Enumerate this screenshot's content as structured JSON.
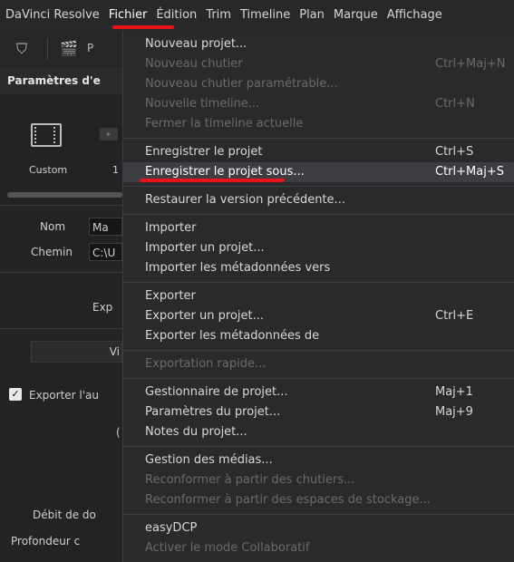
{
  "menubar": {
    "items": [
      "DaVinci Resolve",
      "Fichier",
      "Édition",
      "Trim",
      "Timeline",
      "Plan",
      "Marque",
      "Affichage"
    ],
    "active_index": 1
  },
  "left_panel": {
    "section_title": "Paramètres d'e",
    "preset_custom_label": "Custom",
    "preset_second_label": "1",
    "nom_label": "Nom",
    "nom_value": "Ma",
    "chemin_label": "Chemin",
    "chemin_value": "C:\\U",
    "export_label": "Exp",
    "vi_button": "Vi",
    "export_audio_label": "Exporter l'au",
    "c_label": "(",
    "debit_label": "Débit de do",
    "profondeur_label": "Profondeur c"
  },
  "dropdown": {
    "groups": [
      [
        {
          "label": "Nouveau projet...",
          "shortcut": "",
          "disabled": false
        },
        {
          "label": "Nouveau chutier",
          "shortcut": "Ctrl+Maj+N",
          "disabled": true
        },
        {
          "label": "Nouveau chutier paramétrable...",
          "shortcut": "",
          "disabled": true
        },
        {
          "label": "Nouvelle timeline...",
          "shortcut": "Ctrl+N",
          "disabled": true
        },
        {
          "label": "Fermer la timeline actuelle",
          "shortcut": "",
          "disabled": true
        }
      ],
      [
        {
          "label": "Enregistrer le projet",
          "shortcut": "Ctrl+S",
          "disabled": false
        },
        {
          "label": "Enregistrer le projet sous...",
          "shortcut": "Ctrl+Maj+S",
          "disabled": false,
          "hover": true
        }
      ],
      [
        {
          "label": "Restaurer la version précédente...",
          "shortcut": "",
          "disabled": false
        }
      ],
      [
        {
          "label": "Importer",
          "shortcut": "",
          "disabled": false
        },
        {
          "label": "Importer un projet...",
          "shortcut": "",
          "disabled": false
        },
        {
          "label": "Importer les métadonnées vers",
          "shortcut": "",
          "disabled": false
        }
      ],
      [
        {
          "label": "Exporter",
          "shortcut": "",
          "disabled": false
        },
        {
          "label": "Exporter un projet...",
          "shortcut": "Ctrl+E",
          "disabled": false
        },
        {
          "label": "Exporter les métadonnées de",
          "shortcut": "",
          "disabled": false
        }
      ],
      [
        {
          "label": "Exportation rapide...",
          "shortcut": "",
          "disabled": true
        }
      ],
      [
        {
          "label": "Gestionnaire de projet...",
          "shortcut": "Maj+1",
          "disabled": false
        },
        {
          "label": "Paramètres du projet...",
          "shortcut": "Maj+9",
          "disabled": false
        },
        {
          "label": "Notes du projet...",
          "shortcut": "",
          "disabled": false
        }
      ],
      [
        {
          "label": "Gestion des médias...",
          "shortcut": "",
          "disabled": false
        },
        {
          "label": "Reconformer à partir des chutiers...",
          "shortcut": "",
          "disabled": true
        },
        {
          "label": "Reconformer à partir des espaces de stockage...",
          "shortcut": "",
          "disabled": true
        }
      ],
      [
        {
          "label": "easyDCP",
          "shortcut": "",
          "disabled": false
        },
        {
          "label": "Activer le mode Collaboratif",
          "shortcut": "",
          "disabled": true
        }
      ]
    ]
  },
  "colors": {
    "annotation_red": "#e8141a",
    "menu_bg": "#2a2a2c",
    "hover_bg": "#3e3e42"
  }
}
